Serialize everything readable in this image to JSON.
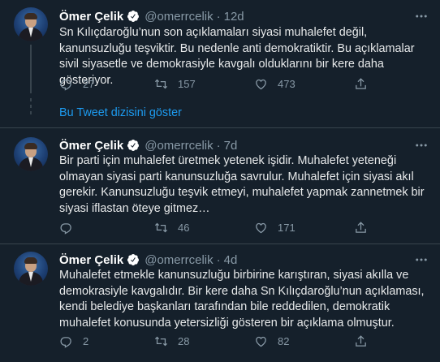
{
  "tweets": [
    {
      "name": "Ömer Çelik",
      "handle": "@omerrcelik",
      "time": "12d",
      "text": "Sn Kılıçdaroğlu’nun son açıklamaları siyasi muhalefet değil, kanunsuzluğu teşviktir. Bu nedenle anti demokratiktir.   Bu açıklamalar sivil siyasetle ve demokrasiyle kavgalı olduklarını bir kere daha gösteriyor.",
      "replies": "27",
      "retweets": "157",
      "likes": "473"
    },
    {
      "name": "Ömer Çelik",
      "handle": "@omerrcelik",
      "time": "7d",
      "text": "Bir parti için muhalefet üretmek yetenek işidir. Muhalefet yeteneği olmayan siyasi parti kanunsuzluğa savrulur. Muhalefet için siyasi akıl gerekir. Kanunsuzluğu teşvik etmeyi, muhalefet yapmak zannetmek bir siyasi iflastan öteye gitmez…",
      "replies": "",
      "retweets": "46",
      "likes": "171"
    },
    {
      "name": "Ömer Çelik",
      "handle": "@omerrcelik",
      "time": "4d",
      "text": "Muhalefet etmekle kanunsuzluğu birbirine karıştıran, siyasi akılla ve demokrasiyle kavgalıdır. Bir kere daha Sn Kılıçdaroğlu’nun açıklaması, kendi belediye başkanları tarafından bile reddedilen, demokratik muhalefet konusunda yetersizliği gösteren bir açıklama olmuştur.",
      "replies": "2",
      "retweets": "28",
      "likes": "82"
    }
  ],
  "show_thread": "Bu Tweet dizisini göster",
  "colors": {
    "background": "#15202b",
    "link": "#1d9bf0",
    "muted": "#8899a6",
    "divider": "#38444d"
  },
  "icons": [
    "verified-icon",
    "more-icon",
    "reply-icon",
    "retweet-icon",
    "like-icon"
  ]
}
